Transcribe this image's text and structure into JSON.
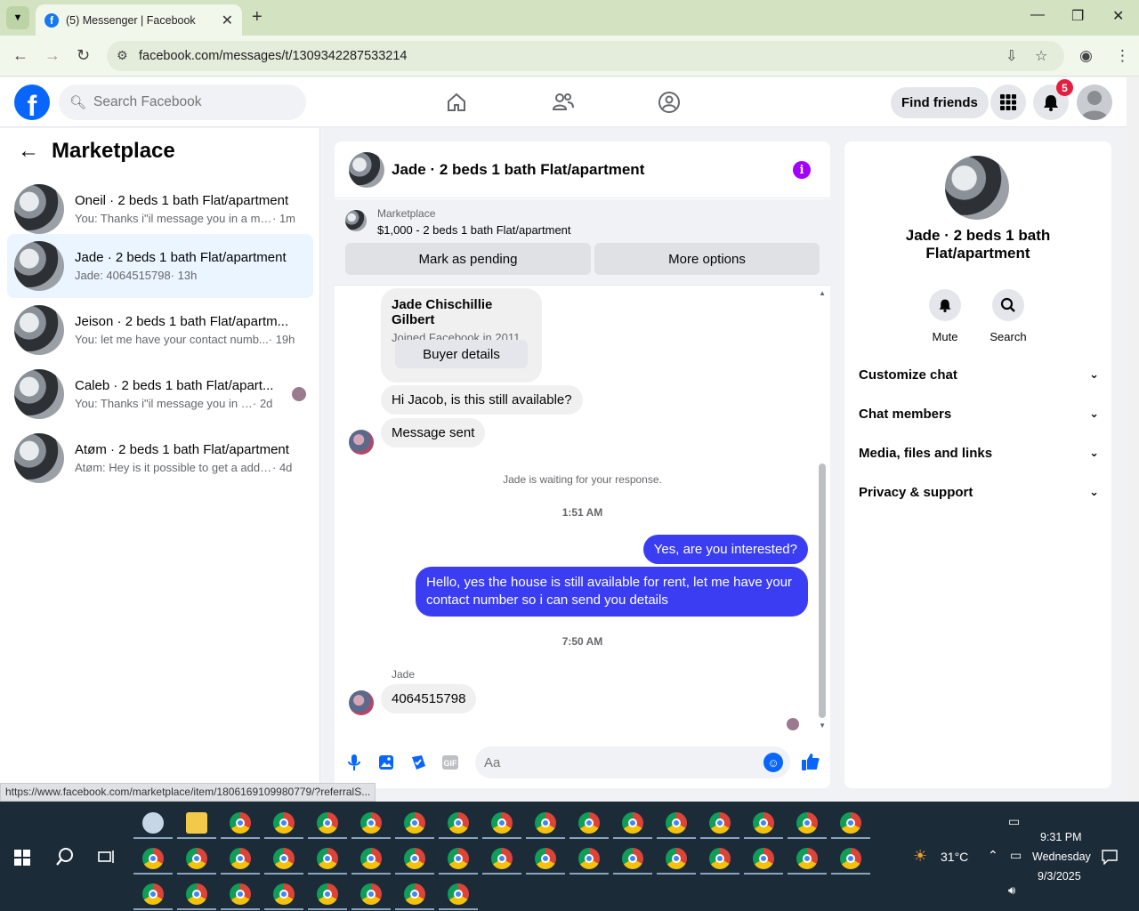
{
  "browser": {
    "tab_title": "(5) Messenger | Facebook",
    "url": "facebook.com/messages/t/1309342287533214",
    "status_url": "https://www.facebook.com/marketplace/item/1806169109980779/?referralS..."
  },
  "fb": {
    "search_placeholder": "Search Facebook",
    "find_friends": "Find friends",
    "notif_count": "5"
  },
  "left": {
    "title": "Marketplace",
    "conversations": [
      {
        "name": "Oneil · 2 beds 1 bath Flat/apartment",
        "preview": "You: Thanks i\"il message you in a mo...",
        "time": "· 1m"
      },
      {
        "name": "Jade · 2 beds 1 bath Flat/apartment",
        "preview": "Jade: 4064515798",
        "time": "· 13h"
      },
      {
        "name": "Jeison · 2 beds 1 bath Flat/apartm...",
        "preview": "You: let me have your contact numb...",
        "time": "· 19h"
      },
      {
        "name": "Caleb · 2 beds 1 bath Flat/apart...",
        "preview": "You: Thanks i\"il message you in a ...",
        "time": "· 2d"
      },
      {
        "name": "Atøm · 2 beds 1 bath Flat/apartment",
        "preview": "Atøm: Hey is it possible to get a addr...",
        "time": "· 4d"
      }
    ]
  },
  "chat": {
    "title": "Jade · 2 beds 1 bath Flat/apartment",
    "marketplace_label": "Marketplace",
    "listing": "$1,000 - 2 beds 1 bath Flat/apartment",
    "mark_pending": "Mark as pending",
    "more_options": "More options",
    "buyer_name": "Jade Chischillie Gilbert",
    "joined": "Joined Facebook in 2011",
    "buyer_details": "Buyer details",
    "msg1": "Hi Jacob, is this still available?",
    "msg2": "Message sent",
    "waiting": "Jade is waiting for your response.",
    "time1": "1:51 AM",
    "out1": "Yes, are you interested?",
    "out2": "Hello, yes the house is still available for rent, let me have your contact number so i can send you details",
    "time2": "7:50 AM",
    "sender": "Jade",
    "msg3": "4064515798",
    "composer_placeholder": "Aa"
  },
  "right": {
    "title": "Jade · 2 beds 1 bath Flat/apartment",
    "mute": "Mute",
    "search": "Search",
    "rows": [
      "Customize chat",
      "Chat members",
      "Media, files and links",
      "Privacy & support"
    ]
  },
  "taskbar": {
    "weather": "31°C",
    "time": "9:31 PM",
    "day": "Wednesday",
    "date": "9/3/2025"
  }
}
